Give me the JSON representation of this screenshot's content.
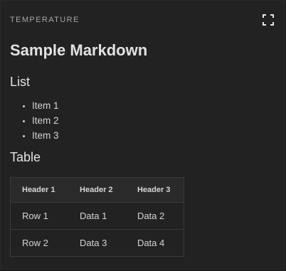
{
  "panel": {
    "title": "TEMPERATURE",
    "fullscreen_icon": "fullscreen-icon"
  },
  "markdown": {
    "title": "Sample Markdown",
    "list_heading": "List",
    "list_items": [
      "Item 1",
      "Item 2",
      "Item 3"
    ],
    "table_heading": "Table",
    "table": {
      "headers": [
        "Header 1",
        "Header 2",
        "Header 3"
      ],
      "rows": [
        [
          "Row 1",
          "Data 1",
          "Data 2"
        ],
        [
          "Row 2",
          "Data 3",
          "Data 4"
        ]
      ]
    }
  }
}
